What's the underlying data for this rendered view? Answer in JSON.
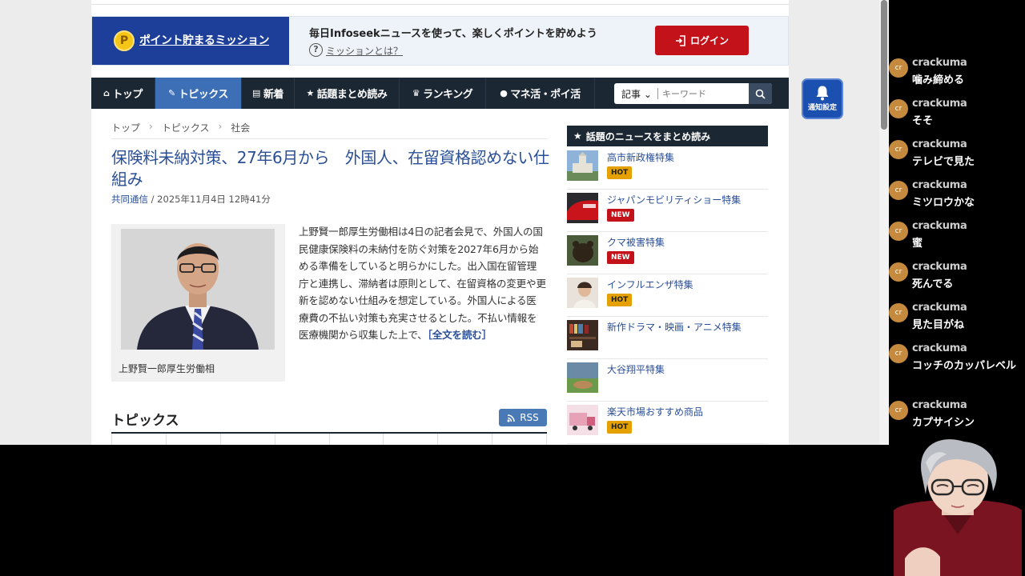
{
  "mission_banner": {
    "coin_glyph": "P",
    "title": "ポイント貯まるミッション",
    "description": "毎日Infoseekニュースを使って、楽しくポイントを貯めよう",
    "help_glyph": "?",
    "link": "ミッションとは？",
    "login_label": "ログイン"
  },
  "nav": {
    "items": [
      {
        "icon": "home-icon",
        "glyph": "⌂",
        "label": "トップ"
      },
      {
        "icon": "pencil-icon",
        "glyph": "✎",
        "label": "トピックス"
      },
      {
        "icon": "document-icon",
        "glyph": "▤",
        "label": "新着"
      },
      {
        "icon": "star-icon",
        "glyph": "★",
        "label": "話題まとめ読み"
      },
      {
        "icon": "crown-icon",
        "glyph": "♛",
        "label": "ランキング"
      },
      {
        "icon": "piggy-bank-icon",
        "glyph": "●",
        "label": "マネ活・ポイ活"
      }
    ],
    "active_index": 1,
    "search": {
      "select_label": "記事 ⌄",
      "placeholder": "キーワード"
    }
  },
  "breadcrumb": {
    "items": [
      "トップ",
      "トピックス",
      "社会"
    ],
    "separator": "›"
  },
  "article": {
    "title": "保険料未納対策、27年6月から　外国人、在留資格認めない仕組み",
    "source": "共同通信",
    "date": " / 2025年11月4日 12時41分",
    "photo_caption": "上野賢一郎厚生労働相",
    "body": "上野賢一郎厚生労働相は4日の記者会見で、外国人の国民健康保険料の未納付を防ぐ対策を2027年6月から始める準備をしていると明らかにした。出入国在留管理庁と連携し、滞納者は原則として、在留資格の変更や更新を認めない仕組みを想定している。外国人による医療費の不払い対策も充実させるとした。不払い情報を医療機関から収集した上で、",
    "read_more": "［全文を読む］"
  },
  "topics": {
    "heading": "トピックス",
    "rss_label": "RSS"
  },
  "side_panel": {
    "heading": "話題のニュースをまとめ読み",
    "heading_glyph": "★",
    "items": [
      {
        "label": "高市新政権特集",
        "badge": "HOT"
      },
      {
        "label": "ジャパンモビリティショー特集",
        "badge": "NEW"
      },
      {
        "label": "クマ被害特集",
        "badge": "NEW"
      },
      {
        "label": "インフルエンザ特集",
        "badge": "HOT"
      },
      {
        "label": "新作ドラマ・映画・アニメ特集",
        "badge": ""
      },
      {
        "label": "大谷翔平特集",
        "badge": ""
      },
      {
        "label": "楽天市場おすすめ商品",
        "badge": "HOT"
      }
    ]
  },
  "notify_button": {
    "label": "通知設定"
  },
  "chat": {
    "avatar_text": "cr",
    "messages": [
      {
        "user": "crackuma",
        "text": "噛み締める"
      },
      {
        "user": "crackuma",
        "text": "そそ"
      },
      {
        "user": "crackuma",
        "text": "テレビで見た"
      },
      {
        "user": "crackuma",
        "text": "ミツロウかな"
      },
      {
        "user": "crackuma",
        "text": "蜜"
      },
      {
        "user": "crackuma",
        "text": "死んでる"
      },
      {
        "user": "crackuma",
        "text": "見た目がね"
      },
      {
        "user": "crackuma",
        "text": "コッチのカッパレベル"
      },
      {
        "user": "crackuma",
        "text": "カプサイシン"
      }
    ]
  },
  "colors": {
    "brand_blue": "#1d3f99",
    "nav_dark": "#1c2734",
    "nav_active": "#3d6fb7",
    "login_red": "#c4121a",
    "link_blue": "#2a4f97",
    "hot_badge": "#e5a100",
    "new_badge": "#c4121a"
  }
}
